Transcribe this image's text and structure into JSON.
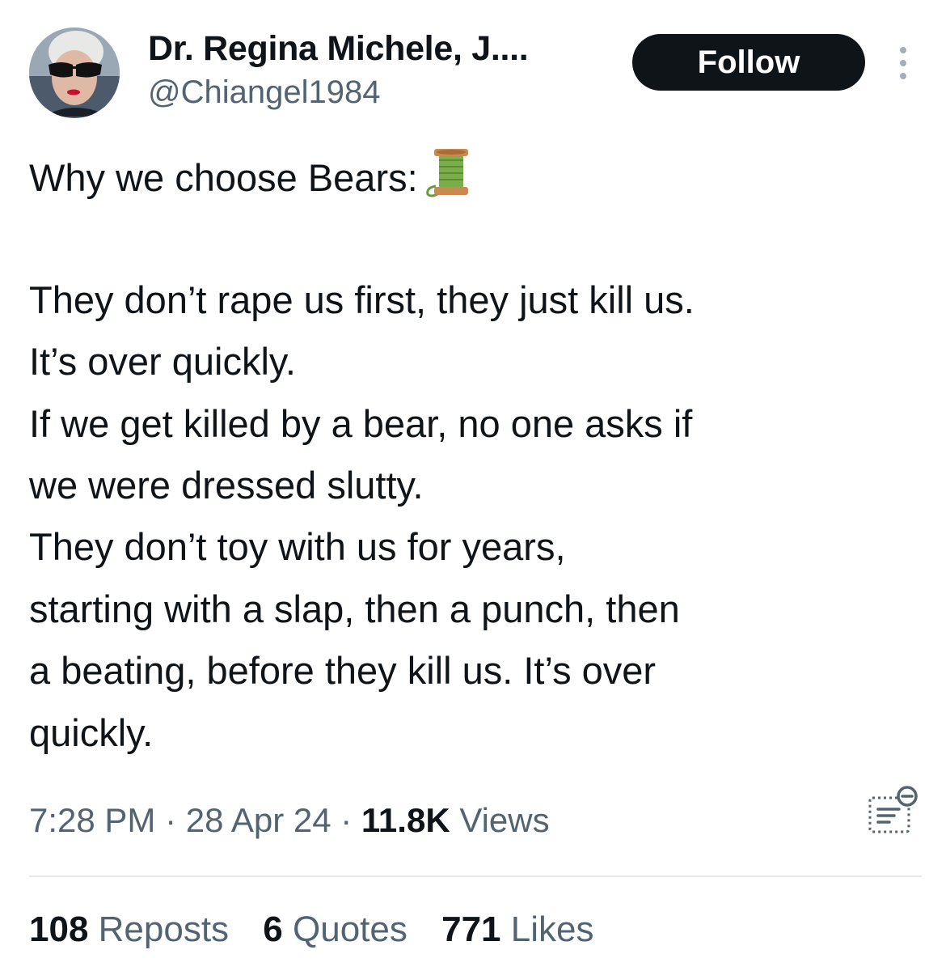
{
  "author": {
    "name": "Dr. Regina Michele, J....",
    "handle": "@Chiangel1984",
    "avatar_icon": "profile-photo-sunglasses"
  },
  "follow_label": "Follow",
  "more_icon": "more-vertical-icon",
  "tweet": {
    "lines": [
      "Why we choose Bears:",
      "",
      "They don’t rape us first, they just kill us.",
      "It’s over quickly.",
      "If we get killed by a bear, no one asks if",
      "we were dressed slutty.",
      "They don’t toy with us for years,",
      "starting with a slap, then a punch, then",
      "a beating, before they kill us. It’s over",
      "quickly."
    ],
    "emoji": "spool-of-thread-emoji"
  },
  "meta": {
    "time": "7:28 PM",
    "separator": " · ",
    "date": "28 Apr 24",
    "views_count": "11.8K",
    "views_label": " Views"
  },
  "analytics_icon": "analytics-icon",
  "stats": {
    "reposts_count": "108",
    "reposts_label": " Reposts",
    "quotes_count": "6",
    "quotes_label": " Quotes",
    "likes_count": "771",
    "likes_label": " Likes"
  },
  "colors": {
    "text": "#0f1419",
    "secondary": "#536471",
    "button_bg": "#0f1419",
    "divider": "#e6e9eb"
  }
}
